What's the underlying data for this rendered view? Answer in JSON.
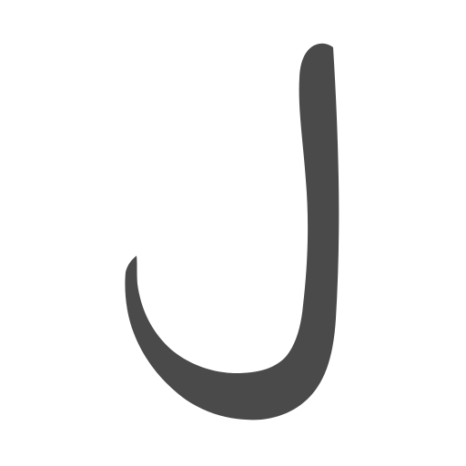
{
  "glyph": {
    "character": "ل",
    "color": "#4a4a4a",
    "background": "#ffffff"
  }
}
